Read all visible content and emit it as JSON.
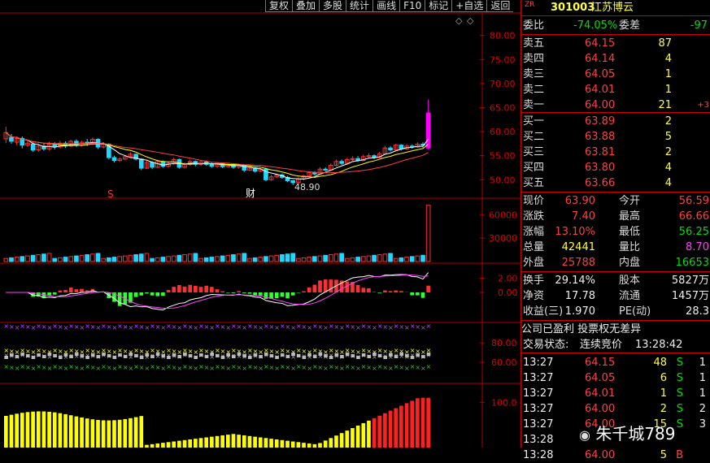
{
  "toolbar": {
    "items": [
      "复权",
      "叠加",
      "多股",
      "统计",
      "画线",
      "F10",
      "标记",
      "+自选",
      "返回"
    ]
  },
  "stock": {
    "prefix": "ZR",
    "code": "301003",
    "name": "江苏博云"
  },
  "quote_header": {
    "wb_label": "委比",
    "wb_value": "-74.05%",
    "wc_label": "委差",
    "wc_value": "-97"
  },
  "sells": [
    {
      "label": "卖五",
      "price": "64.15",
      "vol": "87",
      "chg": ""
    },
    {
      "label": "卖四",
      "price": "64.14",
      "vol": "4",
      "chg": ""
    },
    {
      "label": "卖三",
      "price": "64.05",
      "vol": "1",
      "chg": ""
    },
    {
      "label": "卖二",
      "price": "64.01",
      "vol": "1",
      "chg": ""
    },
    {
      "label": "卖一",
      "price": "64.00",
      "vol": "21",
      "chg": "+3"
    }
  ],
  "buys": [
    {
      "label": "买一",
      "price": "63.89",
      "vol": "2"
    },
    {
      "label": "买二",
      "price": "63.88",
      "vol": "5"
    },
    {
      "label": "买三",
      "price": "63.81",
      "vol": "2"
    },
    {
      "label": "买四",
      "price": "63.80",
      "vol": "4"
    },
    {
      "label": "买五",
      "price": "63.66",
      "vol": "4"
    }
  ],
  "stats": [
    {
      "l1": "现价",
      "v1": "63.90",
      "c1": "red",
      "l2": "今开",
      "v2": "56.59",
      "c2": "red"
    },
    {
      "l1": "涨跌",
      "v1": "7.40",
      "c1": "red",
      "l2": "最高",
      "v2": "66.66",
      "c2": "red"
    },
    {
      "l1": "涨幅",
      "v1": "13.10%",
      "c1": "red",
      "l2": "最低",
      "v2": "56.25",
      "c2": "grn"
    },
    {
      "l1": "总量",
      "v1": "42441",
      "c1": "yel",
      "l2": "量比",
      "v2": "8.70",
      "c2": "mag"
    },
    {
      "l1": "外盘",
      "v1": "25788",
      "c1": "red",
      "l2": "内盘",
      "v2": "16653",
      "c2": "grn"
    }
  ],
  "stats2": [
    {
      "l1": "换手",
      "v1": "29.14%",
      "l2": "股本",
      "v2": "5827万"
    },
    {
      "l1": "净资",
      "v1": "17.78",
      "l2": "流通",
      "v2": "1457万"
    },
    {
      "l1": "收益(三)",
      "v1": "1.970",
      "l2": "PE(动)",
      "v2": "28.3"
    }
  ],
  "notice": "公司已盈利 投票权无差异",
  "trade_status": {
    "label": "交易状态:",
    "value": "连续竞价",
    "time": "13:28:42"
  },
  "ticks": [
    {
      "time": "13:27",
      "price": "64.15",
      "vol": "48",
      "side": "S",
      "n": "1"
    },
    {
      "time": "13:27",
      "price": "64.05",
      "vol": "6",
      "side": "S",
      "n": "1"
    },
    {
      "time": "13:27",
      "price": "64.01",
      "vol": "1",
      "side": "S",
      "n": "1"
    },
    {
      "time": "13:27",
      "price": "64.00",
      "vol": "2",
      "side": "S",
      "n": "2"
    },
    {
      "time": "13:27",
      "price": "64.00",
      "vol": "15",
      "side": "S",
      "n": "3"
    },
    {
      "time": "13:28",
      "price": "",
      "vol": "",
      "side": "",
      "n": ""
    },
    {
      "time": "13:28",
      "price": "64.00",
      "vol": "5",
      "side": "B",
      "n": ""
    }
  ],
  "watermark": "朱千城789",
  "chart_labels": {
    "price_axis": [
      "80.00",
      "75.00",
      "70.00",
      "65.00",
      "60.00",
      "55.00",
      "50.00"
    ],
    "volume_axis": [
      "60000",
      "30000"
    ],
    "macd_axis": [
      "2.00",
      "0.00"
    ],
    "kdj_axis": [
      "80.00",
      "60.00"
    ],
    "last_axis": [
      "100.0"
    ],
    "low_mark": "48.90",
    "cai_mark": "财",
    "s_mark": "S"
  },
  "chart_data": {
    "type": "candlestick",
    "y_range": [
      46.5,
      84.5
    ],
    "candles": [
      [
        58.5,
        59.8,
        57.6,
        61.0
      ],
      [
        58.8,
        58.0,
        57.5,
        59.5
      ],
      [
        57.8,
        58.6,
        57.2,
        59.0
      ],
      [
        58.6,
        57.2,
        56.5,
        59.0
      ],
      [
        57.2,
        57.6,
        56.8,
        58.2
      ],
      [
        57.4,
        56.2,
        55.8,
        57.8
      ],
      [
        56.2,
        57.0,
        55.8,
        57.5
      ],
      [
        57.0,
        56.4,
        56.0,
        57.6
      ],
      [
        56.4,
        57.4,
        56.1,
        57.9
      ],
      [
        57.4,
        56.8,
        56.3,
        57.8
      ],
      [
        56.8,
        57.6,
        56.5,
        58.1
      ],
      [
        57.6,
        57.0,
        56.6,
        58.0
      ],
      [
        57.0,
        58.0,
        56.8,
        58.3
      ],
      [
        58.0,
        57.2,
        56.8,
        58.4
      ],
      [
        57.2,
        57.8,
        56.9,
        58.1
      ],
      [
        57.8,
        57.6,
        57.0,
        58.5
      ],
      [
        57.6,
        58.4,
        57.2,
        58.8
      ],
      [
        58.4,
        56.8,
        56.4,
        58.6
      ],
      [
        56.8,
        57.4,
        56.5,
        57.8
      ],
      [
        57.4,
        54.6,
        54.2,
        57.6
      ],
      [
        54.6,
        54.0,
        53.6,
        55.0
      ],
      [
        54.0,
        54.3,
        53.7,
        54.7
      ],
      [
        54.3,
        54.8,
        54.0,
        55.1
      ],
      [
        54.8,
        55.3,
        54.5,
        55.7
      ],
      [
        55.3,
        54.3,
        54.0,
        55.5
      ],
      [
        54.3,
        52.4,
        52.0,
        54.5
      ],
      [
        52.4,
        53.6,
        52.2,
        54.0
      ],
      [
        53.6,
        52.6,
        52.2,
        53.9
      ],
      [
        52.6,
        53.8,
        52.4,
        54.2
      ],
      [
        53.8,
        52.8,
        52.5,
        54.0
      ],
      [
        52.8,
        53.4,
        52.5,
        53.8
      ],
      [
        53.4,
        54.2,
        53.1,
        54.6
      ],
      [
        54.2,
        52.6,
        52.3,
        54.4
      ],
      [
        52.6,
        53.2,
        52.4,
        53.6
      ],
      [
        53.2,
        53.8,
        52.9,
        54.2
      ],
      [
        53.8,
        53.2,
        52.8,
        54.0
      ],
      [
        53.2,
        53.7,
        52.9,
        54.0
      ],
      [
        53.7,
        53.2,
        52.9,
        54.0
      ],
      [
        53.2,
        52.8,
        52.5,
        53.6
      ],
      [
        52.8,
        53.4,
        52.5,
        53.7
      ],
      [
        53.4,
        52.7,
        52.4,
        53.6
      ],
      [
        52.7,
        53.2,
        52.5,
        53.5
      ],
      [
        53.2,
        52.6,
        52.3,
        53.4
      ],
      [
        52.6,
        53.0,
        52.3,
        53.3
      ],
      [
        53.0,
        52.0,
        51.6,
        53.2
      ],
      [
        52.0,
        52.4,
        51.8,
        52.7
      ],
      [
        52.4,
        51.8,
        51.5,
        52.6
      ],
      [
        51.8,
        52.2,
        51.6,
        52.4
      ],
      [
        52.2,
        50.0,
        49.7,
        52.5
      ],
      [
        50.0,
        50.6,
        49.8,
        51.0
      ],
      [
        50.6,
        51.0,
        50.3,
        51.3
      ],
      [
        51.0,
        50.5,
        50.2,
        51.3
      ],
      [
        50.5,
        49.8,
        49.5,
        50.8
      ],
      [
        49.8,
        49.4,
        48.9,
        50.0
      ],
      [
        49.4,
        50.2,
        49.1,
        50.5
      ],
      [
        50.2,
        50.8,
        49.9,
        51.0
      ],
      [
        50.8,
        51.5,
        50.6,
        51.8
      ],
      [
        51.5,
        51.2,
        50.9,
        51.8
      ],
      [
        51.2,
        52.2,
        51.0,
        52.6
      ],
      [
        52.2,
        52.0,
        51.7,
        52.6
      ],
      [
        52.0,
        53.0,
        51.8,
        53.4
      ],
      [
        53.0,
        53.8,
        52.8,
        54.2
      ],
      [
        53.8,
        53.4,
        53.1,
        54.2
      ],
      [
        53.4,
        54.2,
        53.1,
        54.6
      ],
      [
        54.2,
        54.4,
        53.9,
        54.9
      ],
      [
        54.4,
        54.0,
        53.7,
        54.9
      ],
      [
        54.0,
        54.8,
        53.8,
        55.2
      ],
      [
        54.8,
        55.0,
        54.5,
        55.5
      ],
      [
        55.0,
        54.6,
        54.3,
        55.3
      ],
      [
        54.6,
        55.4,
        54.4,
        55.8
      ],
      [
        55.4,
        56.6,
        55.2,
        57.0
      ],
      [
        56.6,
        56.2,
        55.9,
        57.0
      ],
      [
        56.2,
        57.2,
        56.0,
        57.5
      ],
      [
        57.2,
        56.4,
        56.1,
        57.4
      ],
      [
        56.4,
        57.0,
        56.2,
        57.4
      ],
      [
        57.0,
        56.8,
        56.5,
        57.3
      ],
      [
        56.8,
        57.4,
        56.6,
        57.8
      ],
      [
        57.4,
        57.2,
        56.7,
        57.8
      ],
      [
        56.6,
        63.9,
        56.25,
        66.66
      ]
    ],
    "ma5_start": 58.2,
    "ma5_low": 50.8,
    "ma5_end": 55.6,
    "volume_range": [
      0,
      80000
    ],
    "macd_range": [
      -4,
      4
    ],
    "kdj_range": [
      40,
      100
    ]
  },
  "colors": {
    "up": "#ff3030",
    "down": "#20d8ff",
    "border": "#c00000",
    "last_up": "#ff00ff"
  }
}
